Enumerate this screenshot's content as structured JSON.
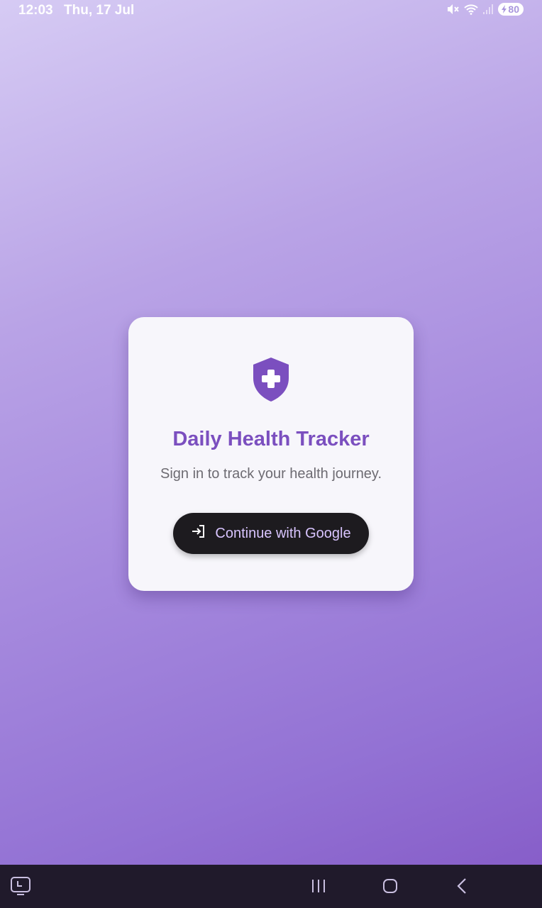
{
  "status_bar": {
    "time": "12:03",
    "date": "Thu, 17 Jul",
    "battery_level": "80",
    "icons": [
      "mute-icon",
      "wifi-icon",
      "signal-icon",
      "battery-charging-icon"
    ]
  },
  "login_card": {
    "icon": "shield-plus-icon",
    "title": "Daily Health Tracker",
    "subtitle": "Sign in to track your health journey.",
    "button_icon": "login-icon",
    "button_label": "Continue with Google"
  },
  "nav_bar": {
    "items": [
      "screen-recorder-icon",
      "recent-apps-icon",
      "home-icon",
      "back-icon"
    ]
  },
  "colors": {
    "accent": "#7b4fbf",
    "button_bg": "#1d1b1f",
    "button_text": "#d9c5ff",
    "card_bg": "#f7f6fb",
    "nav_bg": "#201a2b"
  }
}
